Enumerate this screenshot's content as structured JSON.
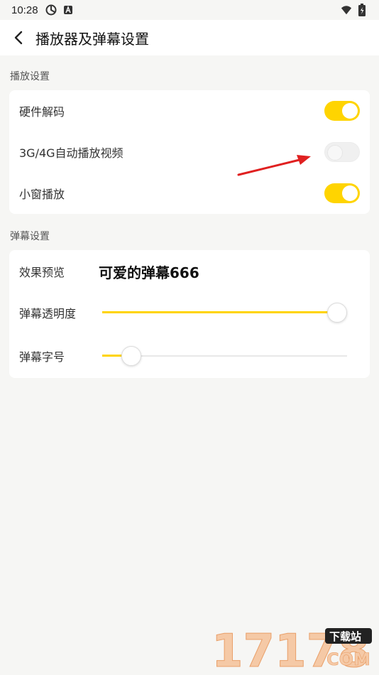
{
  "status_bar": {
    "time": "10:28"
  },
  "header": {
    "title": "播放器及弹幕设置"
  },
  "sections": {
    "playback": {
      "title": "播放设置",
      "items": [
        {
          "label": "硬件解码",
          "on": true
        },
        {
          "label": "3G/4G自动播放视频",
          "on": false
        },
        {
          "label": "小窗播放",
          "on": true
        }
      ]
    },
    "danmaku": {
      "title": "弹幕设置",
      "preview_label": "效果预览",
      "preview_text": "可爱的弹幕666",
      "opacity_label": "弹幕透明度",
      "opacity_value": 1.0,
      "font_size_label": "弹幕字号",
      "font_size_value": 0.12
    }
  },
  "colors": {
    "accent": "#ffd400",
    "background": "#f6f6f4",
    "card": "#ffffff"
  },
  "watermark": {
    "text": "17178",
    "badge": "下载站",
    "suffix": "COM"
  }
}
